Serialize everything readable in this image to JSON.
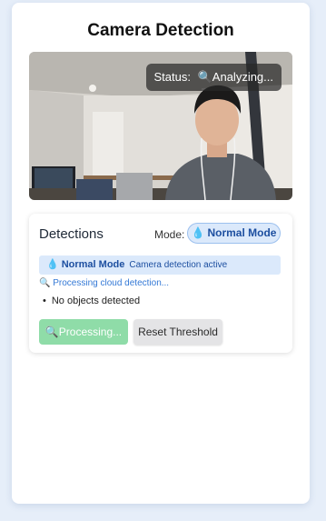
{
  "app": {
    "title": "Camera Detection"
  },
  "camera": {
    "status_label": "Status:",
    "status_icon": "magnifier-icon",
    "status_text": "Analyzing..."
  },
  "detections": {
    "title": "Detections",
    "mode_label": "Mode:",
    "mode_value": "Normal Mode",
    "mode_icon": "water-drop-icon",
    "banner_mode": "Normal Mode",
    "banner_text": "Camera detection active",
    "processing_note": "Processing cloud detection...",
    "items": [
      "No objects detected"
    ]
  },
  "buttons": {
    "processing_label": "Processing...",
    "reset_label": "Reset Threshold"
  },
  "colors": {
    "accent": "#1d4fa0",
    "mode_bg": "#dbe9fb",
    "processing_button": "#8fdca8"
  }
}
